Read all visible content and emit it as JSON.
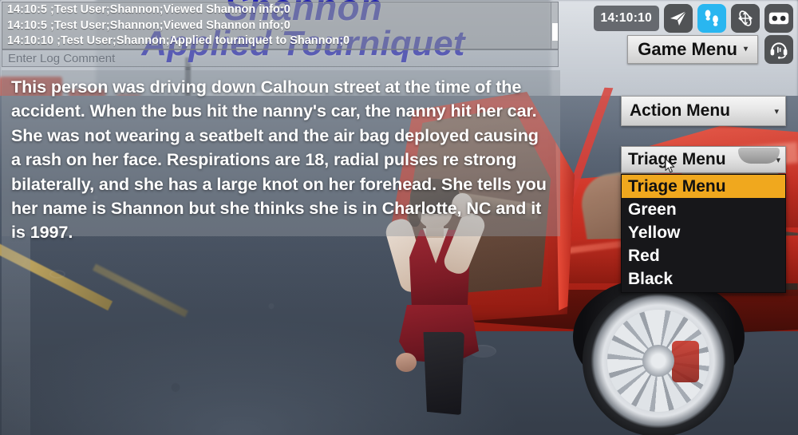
{
  "app": {
    "type": "3d-medical-triage-simulation"
  },
  "event_banner": {
    "line1": "Shannon",
    "line2": "Applied Tourniquet",
    "color": "#2222b4"
  },
  "log_panel": {
    "entries": [
      "14:10:5 ;Test User;Shannon;Viewed Shannon info;0",
      "14:10:5 ;Test User;Shannon;Viewed Shannon info;0",
      "14:10:10 ;Test User;Shannon;Applied tourniquet to Shannon;0"
    ],
    "comment_input": {
      "value": "",
      "placeholder": "Enter Log Comment"
    }
  },
  "narrative": {
    "text": "This person was driving down Calhoun street at the time of the accident. When the bus hit the nanny's car, the nanny hit her car. She was not wearing a seatbelt and the air bag deployed causing a rash on her face. Respirations are 18, radial pulses re strong bilaterally, and she has a large knot on her forehead. She tells you her name is Shannon but she thinks she is in Charlotte, NC and it is 1997."
  },
  "toolbar": {
    "timer": "14:10:10",
    "buttons": [
      {
        "name": "teleport-icon",
        "label": "Teleport",
        "active": false
      },
      {
        "name": "walk-icon",
        "label": "Walk",
        "active": true
      },
      {
        "name": "orbit-icon",
        "label": "Orbit",
        "active": false
      },
      {
        "name": "vr-headset-icon",
        "label": "VR Mode",
        "active": false
      }
    ],
    "active_color": "#29b6f0"
  },
  "game_menu": {
    "label": "Game Menu",
    "caret": "▾",
    "voice_icon": "headset-mic-icon"
  },
  "action_menu": {
    "label": "Action Menu",
    "caret": "▾"
  },
  "triage_menu": {
    "label": "Triage Menu",
    "caret": "▾",
    "expanded": true,
    "selected": "Triage Menu",
    "highlight_color": "#f0a81e",
    "options": [
      "Triage Menu",
      "Green",
      "Yellow",
      "Red",
      "Black"
    ]
  }
}
